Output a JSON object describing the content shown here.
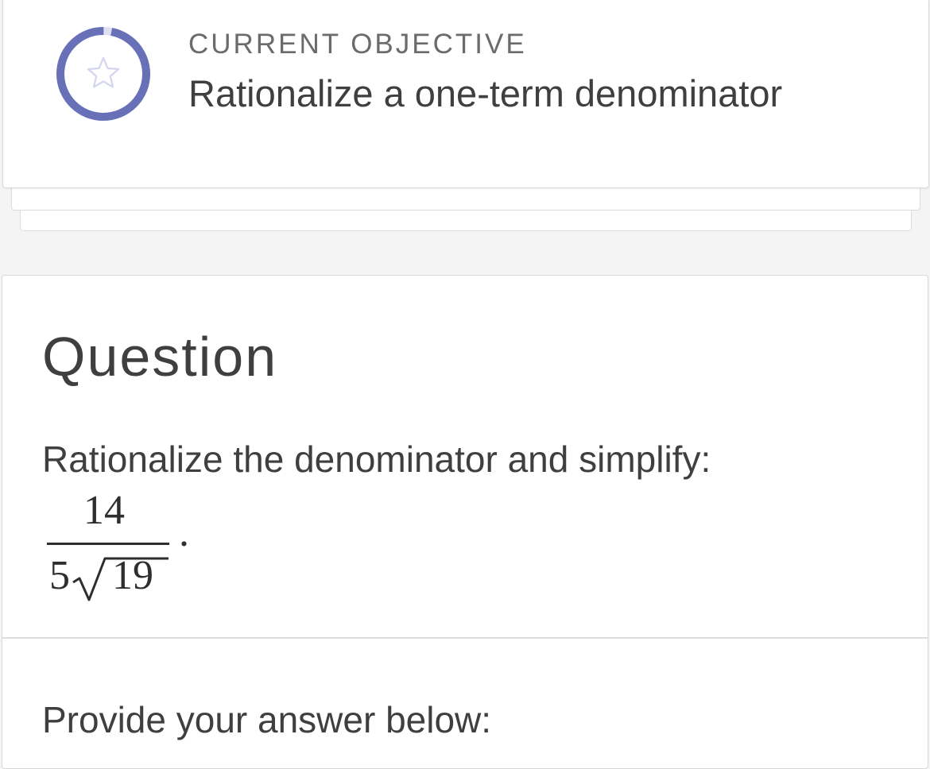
{
  "objective": {
    "label": "CURRENT OBJECTIVE",
    "title": "Rationalize a one-term denominator",
    "progress_fraction": 0.97,
    "icon": "star-icon",
    "ring_color": "#6870b8",
    "ring_track_color": "#dde0f3"
  },
  "question": {
    "heading": "Question",
    "prompt": "Rationalize the denominator and simplify:",
    "expression": {
      "numerator": "14",
      "coefficient": "5",
      "radicand": "19",
      "trailing": "."
    }
  },
  "answer": {
    "prompt": "Provide your answer below:"
  }
}
